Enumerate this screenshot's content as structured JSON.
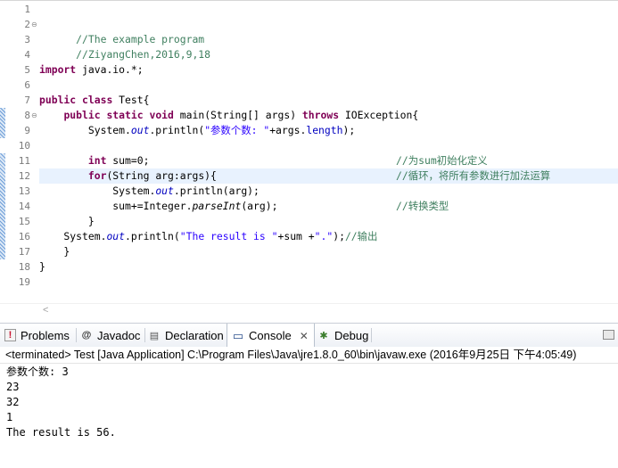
{
  "editor": {
    "line_numbers": [
      "1",
      "2",
      "3",
      "4",
      "5",
      "6",
      "7",
      "8",
      "9",
      "10",
      "11",
      "12",
      "13",
      "14",
      "15",
      "16",
      "17",
      "18",
      "19"
    ],
    "fold_markers": [
      "⊖",
      "⊖"
    ],
    "l2_comment": "//The example program",
    "l3_comment": "//ZiyangChen,2016,9,18",
    "l5_keyword": "import",
    "l5_rest": " java.io.*;",
    "l7_kw1": "public",
    "l7_kw2": "class",
    "l7_rest": " Test{",
    "l8_indent": "    ",
    "l8_kw1": "public",
    "l8_kw2": "static",
    "l8_kw3": "void",
    "l8_mid": " main(String[] args) ",
    "l8_kw4": "throws",
    "l8_rest": " IOException{",
    "l9_a": "        System.",
    "l9_out": "out",
    "l9_b": ".println(",
    "l9_str": "\"参数个数: \"",
    "l9_c": "+args.",
    "l9_len": "length",
    "l9_d": ");",
    "l11_indent": "        ",
    "l11_kw": "int",
    "l11_rest": " sum=0;",
    "l11_comment": "//为sum初始化定义",
    "l12_indent": "        ",
    "l12_kw": "for",
    "l12_rest": "(String arg:args){",
    "l12_comment": "//循环，将所有参数进行加法运算",
    "l13_a": "            System.",
    "l13_out": "out",
    "l13_b": ".println(arg);",
    "l14_a": "            sum+=Integer.",
    "l14_method": "parseInt",
    "l14_b": "(arg);",
    "l14_comment": "//转换类型",
    "l15_text": "        }",
    "l16_a": "    System.",
    "l16_out": "out",
    "l16_b": ".println(",
    "l16_str1": "\"The result is \"",
    "l16_c": "+sum +",
    "l16_str2": "\".\"",
    "l16_d": ");",
    "l16_comment": "//输出",
    "l17_text": "    }",
    "l18_text": "}",
    "scroll_arrow": "<"
  },
  "tabs": [
    {
      "label": "Problems",
      "icon": "!"
    },
    {
      "label": "Javadoc",
      "icon": "@"
    },
    {
      "label": "Declaration",
      "icon": "▤"
    },
    {
      "label": "Console",
      "icon": "▭",
      "close": "✕"
    },
    {
      "label": "Debug",
      "icon": "✱"
    }
  ],
  "console": {
    "header": "<terminated> Test [Java Application] C:\\Program Files\\Java\\jre1.8.0_60\\bin\\javaw.exe (2016年9月25日 下午4:05:49)",
    "output": [
      "参数个数: 3",
      "23",
      "32",
      "1",
      "The result is 56."
    ]
  },
  "colors": {
    "keyword": "#7f0055",
    "comment": "#3f7f5f",
    "string": "#2a00ff",
    "field": "#0000c0",
    "current_line": "#e8f2fe"
  }
}
